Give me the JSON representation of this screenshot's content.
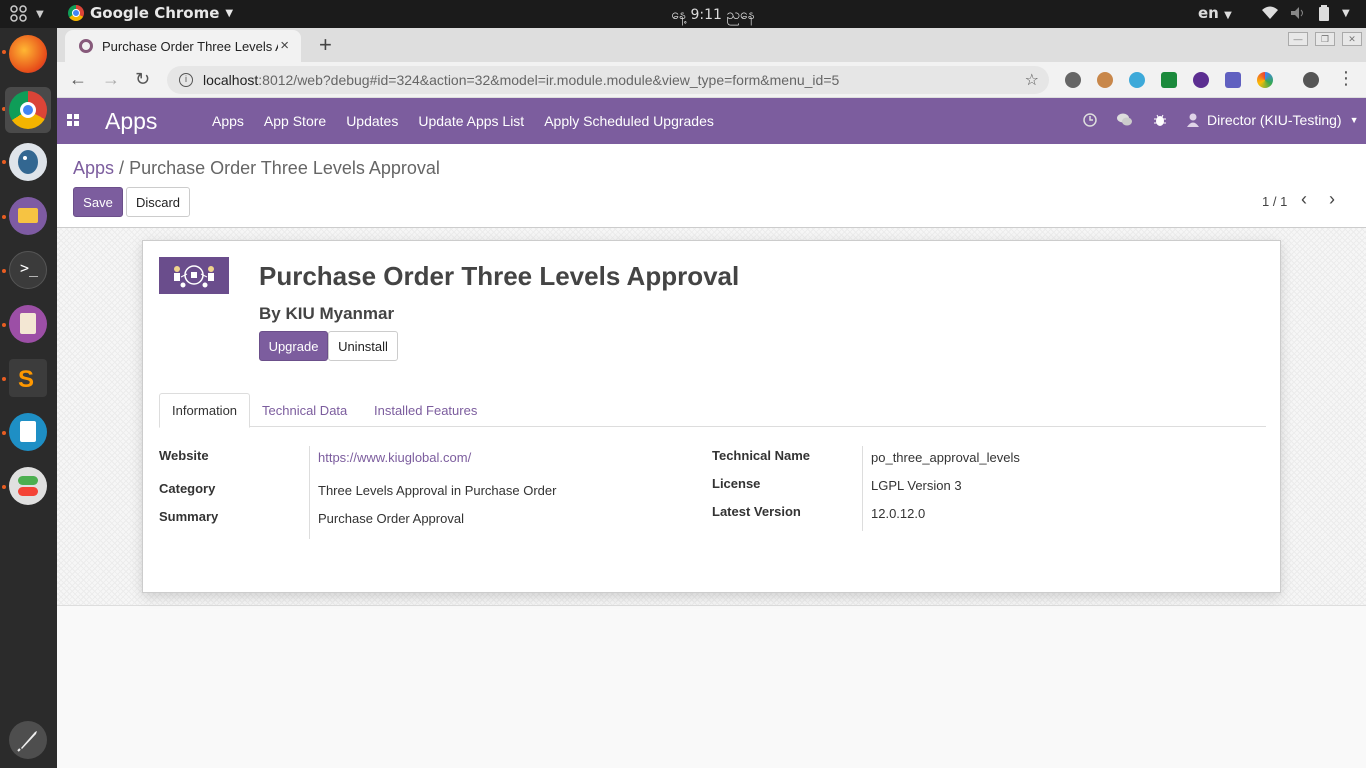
{
  "os_topbar": {
    "app_name": "Google Chrome",
    "clock": "နေ့ 9:11 ညနေ",
    "language": "en"
  },
  "browser": {
    "tab_title": "Purchase Order Three Levels Approval",
    "tab_close": "×",
    "new_tab": "+",
    "url_host": "localhost",
    "url_rest": ":8012/web?debug#id=324&action=32&model=ir.module.module&view_type=form&menu_id=5"
  },
  "navbar": {
    "brand": "Apps",
    "menu": [
      "Apps",
      "App Store",
      "Updates",
      "Update Apps List",
      "Apply Scheduled Upgrades"
    ],
    "user": "Director (KIU-Testing)"
  },
  "control_panel": {
    "breadcrumb_parent": "Apps",
    "breadcrumb_separator": "/",
    "breadcrumb_current": "Purchase Order Three Levels Approval",
    "save_label": "Save",
    "discard_label": "Discard",
    "pager": "1 / 1"
  },
  "module": {
    "title": "Purchase Order Three Levels Approval",
    "author": "By KIU Myanmar",
    "upgrade_label": "Upgrade",
    "uninstall_label": "Uninstall"
  },
  "tabs": [
    "Information",
    "Technical Data",
    "Installed Features"
  ],
  "fields_left": [
    {
      "label": "Website",
      "value": "https://www.kiuglobal.com/",
      "link": true
    },
    {
      "label": "Category",
      "value": "Three Levels Approval in Purchase Order"
    },
    {
      "label": "Summary",
      "value": "Purchase Order Approval"
    }
  ],
  "fields_right": [
    {
      "label": "Technical Name",
      "value": "po_three_approval_levels"
    },
    {
      "label": "License",
      "value": "LGPL Version 3"
    },
    {
      "label": "Latest Version",
      "value": "12.0.12.0"
    }
  ],
  "colors": {
    "odoo_primary": "#7c5d9e",
    "topbar": "#1b1b1b",
    "launcher": "#2b2b2b"
  }
}
